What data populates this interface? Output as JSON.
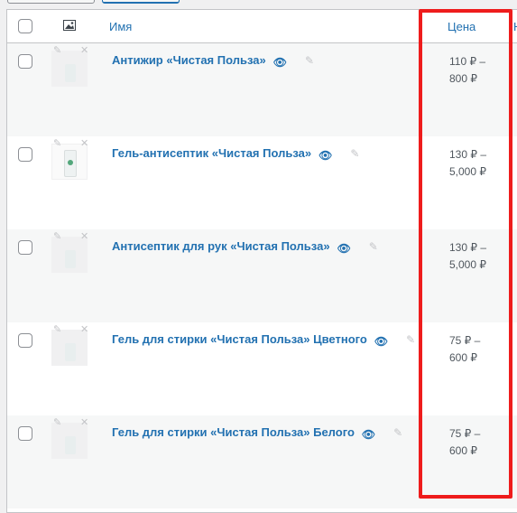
{
  "table": {
    "headers": {
      "name": "Имя",
      "price": "Цена",
      "next_col": "Н"
    },
    "rows": [
      {
        "name": "Антижир «Чистая Польза»",
        "price_line1": "110 ₽ –",
        "price_line2": "800 ₽",
        "image": "placeholder"
      },
      {
        "name": "Гель-антисептик «Чистая Польза»",
        "price_line1": "130 ₽ –",
        "price_line2": "5,000 ₽",
        "image": "product-photo"
      },
      {
        "name": "Антисептик для рук «Чистая Польза»",
        "price_line1": "130 ₽ –",
        "price_line2": "5,000 ₽",
        "image": "placeholder"
      },
      {
        "name": "Гель для стирки «Чистая Польза» Цветного",
        "price_line1": "75 ₽ –",
        "price_line2": "600 ₽",
        "image": "placeholder"
      },
      {
        "name": "Гель для стирки «Чистая Польза» Белого",
        "price_line1": "75 ₽ –",
        "price_line2": "600 ₽",
        "image": "placeholder"
      }
    ]
  },
  "icons": {
    "thumbnail_header": "image-icon",
    "view": "eye-icon",
    "edit": "pencil-icon",
    "remove_image": "close-icon"
  },
  "colors": {
    "link": "#2271b1",
    "highlight": "#ee1c1c",
    "row_alt": "#f6f7f7"
  }
}
